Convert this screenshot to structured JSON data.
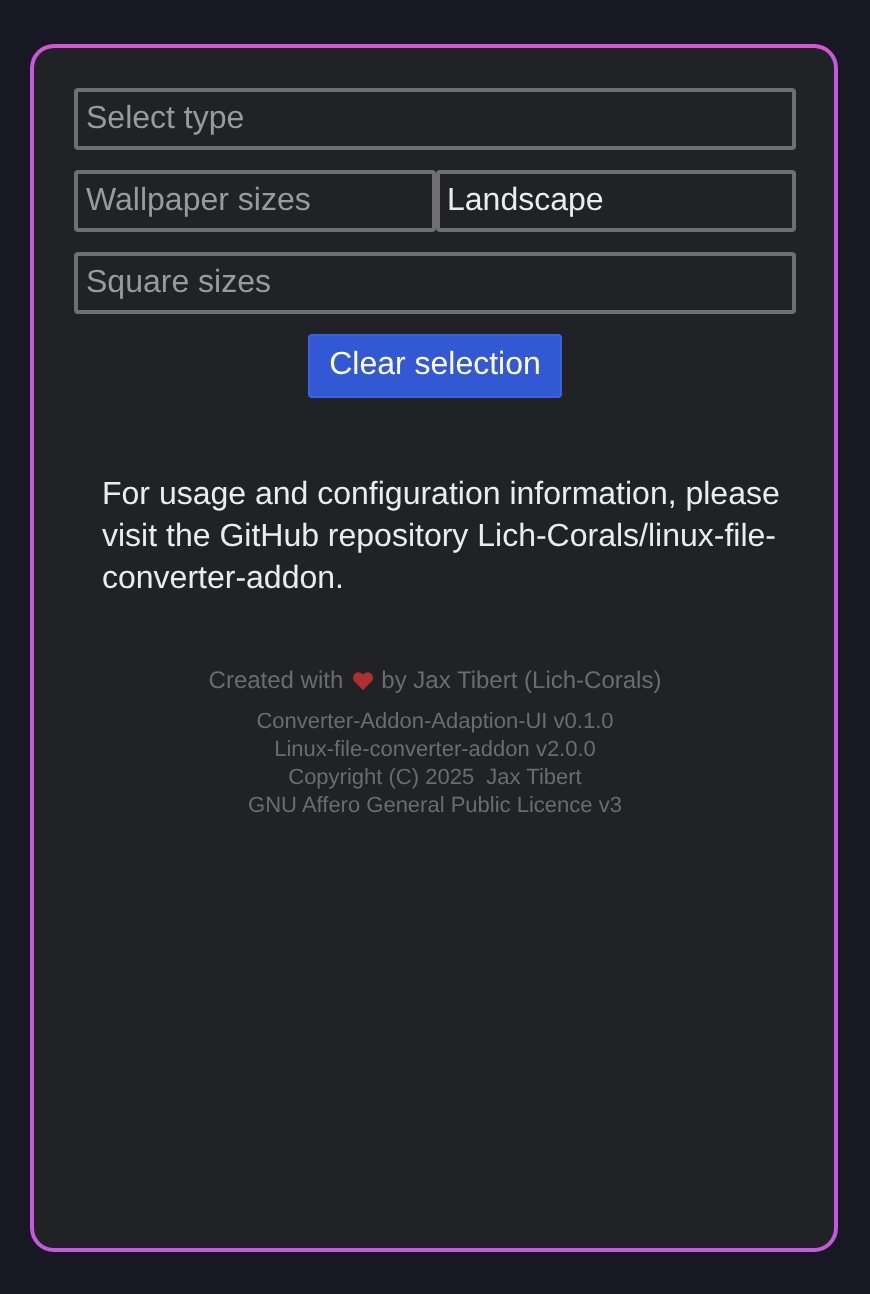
{
  "fields": [
    {
      "placeholder": "Select type"
    },
    {
      "placeholder": "Wallpaper sizes"
    },
    {
      "value": "Landscape"
    },
    {
      "placeholder": "Square sizes"
    }
  ],
  "clear_button": "Clear selection",
  "info": "For usage and configuration information, please visit the GitHub repository Lich-Corals/linux-file-converter-addon.",
  "credit": {
    "before": "Created with",
    "after": "by Jax Tibert (Lich-Corals)"
  },
  "version_lines": [
    "Converter-Addon-Adaption-UI v0.1.0",
    "Linux-file-converter-addon v2.0.0",
    "Copyright (C) 2025  Jax Tibert",
    "GNU Affero General Public Licence v3"
  ]
}
